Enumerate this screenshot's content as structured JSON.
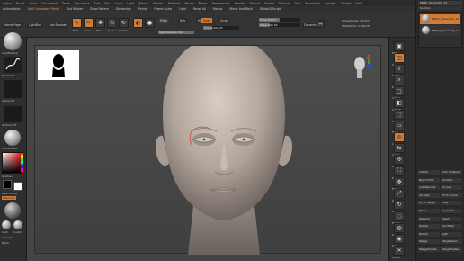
{
  "menu": [
    "Alpha",
    "Brush",
    "Color",
    "Document",
    "Draw",
    "Dynamics",
    "Edit",
    "File",
    "Layer",
    "Light",
    "Macro",
    "Marker",
    "Material",
    "Movie",
    "Picker",
    "Preferences",
    "Render",
    "Stencil",
    "Stroke",
    "Texture",
    "Tool",
    "Transform",
    "Zplugin",
    "Zscript",
    "Help"
  ],
  "subbar": {
    "activepoints": "ActivePoints",
    "spotlight": "Split Unmasked Points",
    "quicksave": "QuickSave",
    "see_through": "See-through",
    "menus": "Menus",
    "default_zscript": "DefaultZScript",
    "items": [
      "AC/Default",
      "Dist Marker",
      "Draw Pattern",
      "Dimension",
      "Points",
      "Frame Scale",
      "Light",
      "Reset All",
      "Solo",
      "Cursor",
      "Mirror",
      "Mirror And Weld"
    ]
  },
  "toolbar": {
    "home_page": "Home Page",
    "lightbox": "LightBox",
    "live_boolean": "Live Boolean",
    "edit": "Edit",
    "draw": "Draw",
    "move": "Move",
    "scale": "Scale",
    "rotate": "Rotate",
    "mrgb": "Mrgb",
    "rgb": "Rgb",
    "m": "M",
    "zadd": "Zadd",
    "zsub": "Zsub",
    "zcut": "Zcut",
    "focal_shift": "Focal Shift 0",
    "draw_size": "Draw Size 64",
    "z_intensity": "Z Intensity 25",
    "rgb_intensity": "Rgb Intensity 100",
    "dynamic": "Dynamic",
    "active_points": "ActivePoints: 26,527",
    "total_points": "TotalPoints: 4.346 Mil"
  },
  "left_shelf": {
    "brush_label": "ClayBuildup",
    "stroke_label": "FreeHand",
    "alpha_label": "Alpha Off",
    "texture_label": "Texture Off",
    "material_label": "SkinShade4",
    "gradient": "Gradient",
    "switch_color": "SwitchColor",
    "alternate": "Alternate",
    "grid_labels": [
      "Cust",
      "Cust2",
      "Clear To",
      "Black"
    ]
  },
  "right_shelf": {
    "labels": [
      "BPR",
      "SPix 3",
      "Scroll",
      "Zoom",
      "Actual",
      "AAHalf",
      "Persp",
      "Floor",
      "Local",
      "L.Sym",
      "Xyz",
      "Frame",
      "Move",
      "ZoomD",
      "Rotate",
      "Transp",
      "Ghost",
      "Solo",
      "Xpose"
    ]
  },
  "tray": {
    "title": "PM3D_Sphere3D_10",
    "subtool_title": "Subtool",
    "items": [
      "PM3D_Sphere3D_10",
      "PM3D_Sphere3D_11"
    ],
    "buttons": [
      "List All",
      "Auto Collapse",
      "New Folder",
      "Rename",
      "AutoReorder",
      "All Low",
      "All High",
      "All To Home",
      "All To Target",
      "Copy",
      "Paste",
      "Duplicate",
      "Append",
      "Insert",
      "Delete",
      "Del Other",
      "Del All",
      "Split",
      "Merge",
      "MergeDown",
      "MergeSimilar",
      "MergeVisible"
    ]
  },
  "colors": {
    "accent": "#d27b35",
    "canvas": "#474747",
    "panel": "#2e2e2e",
    "highlight": "#d04040"
  }
}
